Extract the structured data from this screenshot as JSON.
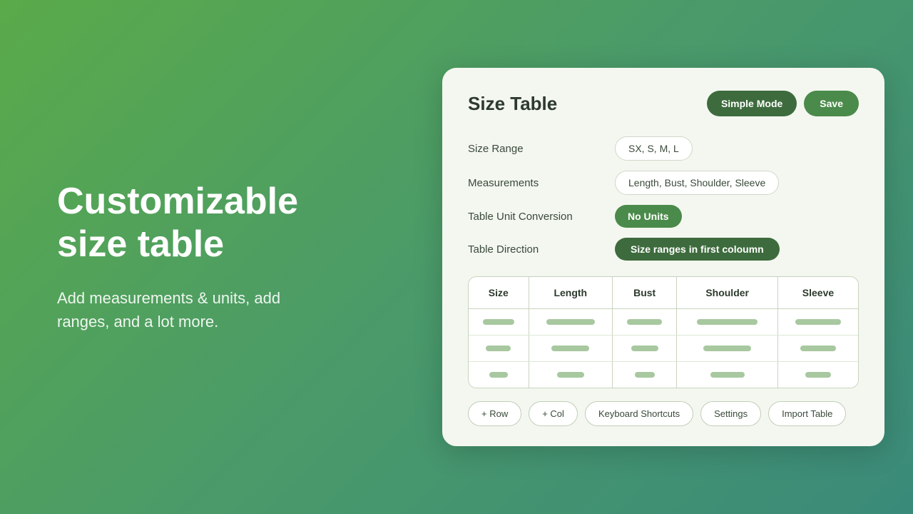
{
  "left": {
    "headline_line1": "Customizable",
    "headline_line2": "size table",
    "description": "Add measurements & units, add ranges, and a lot more."
  },
  "card": {
    "title": "Size Table",
    "buttons": {
      "simple_mode": "Simple Mode",
      "save": "Save"
    },
    "fields": {
      "size_range": {
        "label": "Size Range",
        "value": "SX, S, M, L"
      },
      "measurements": {
        "label": "Measurements",
        "value": "Length, Bust, Shoulder, Sleeve"
      },
      "table_unit_conversion": {
        "label": "Table Unit Conversion",
        "value": "No Units"
      },
      "table_direction": {
        "label": "Table Direction",
        "value": "Size ranges in first coloumn"
      }
    },
    "table": {
      "columns": [
        "Size",
        "Length",
        "Bust",
        "Shoulder",
        "Sleeve"
      ],
      "rows": [
        [
          "large",
          "large",
          "large",
          "large",
          "large"
        ],
        [
          "medium",
          "medium",
          "medium",
          "medium",
          "medium"
        ],
        [
          "small",
          "small",
          "small",
          "small",
          "small"
        ]
      ]
    },
    "bottom_buttons": [
      "+ Row",
      "+ Col",
      "Keyboard Shortcuts",
      "Settings",
      "Import Table"
    ]
  }
}
